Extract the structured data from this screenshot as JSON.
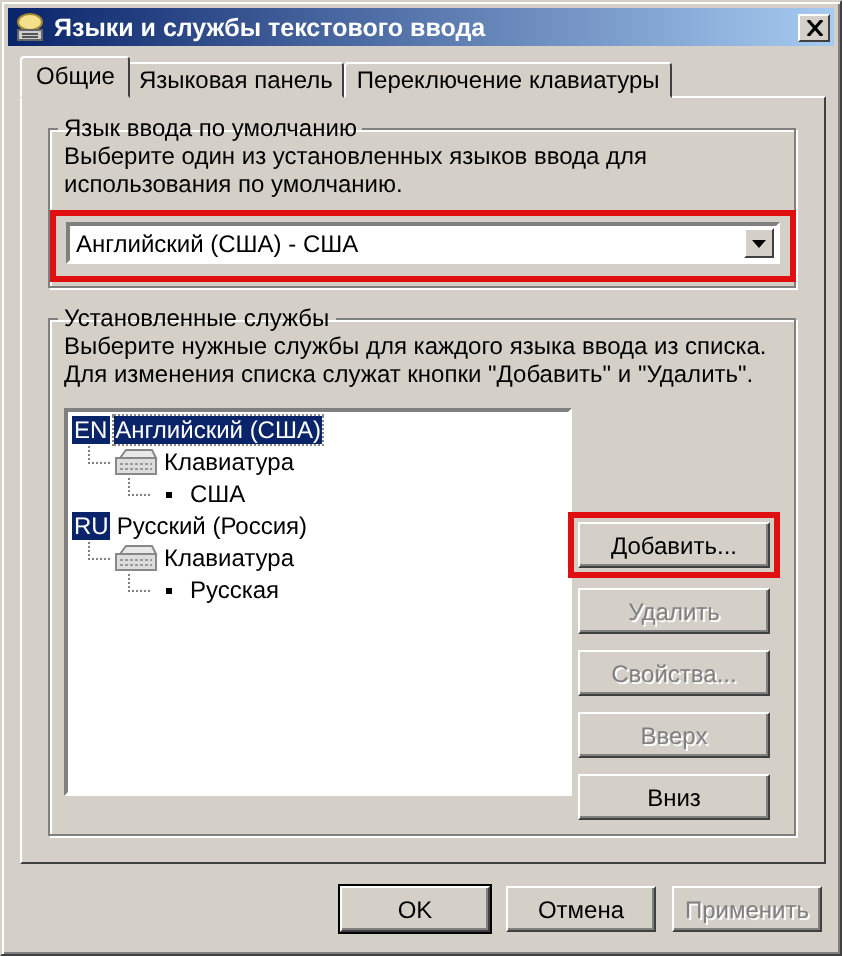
{
  "window": {
    "title": "Языки и службы текстового ввода"
  },
  "tabs": [
    {
      "label": "Общие",
      "selected": true
    },
    {
      "label": "Языковая панель",
      "selected": false
    },
    {
      "label": "Переключение клавиатуры",
      "selected": false
    }
  ],
  "default_language": {
    "legend": "Язык ввода по умолчанию",
    "description": "Выберите один из установленных языков ввода для использования по умолчанию.",
    "value": "Английский (США) - США",
    "highlighted": true
  },
  "installed_services": {
    "legend": "Установленные службы",
    "description": "Выберите нужные службы для каждого языка ввода из списка. Для изменения списка служат кнопки \"Добавить\" и \"Удалить\".",
    "tree": [
      {
        "kind": "language",
        "badge": "EN",
        "label": "Английский (США)",
        "selected": true,
        "children": [
          {
            "kind": "category",
            "label": "Клавиатура",
            "selected": false,
            "children": [
              {
                "kind": "service",
                "label": "США",
                "selected": false
              }
            ]
          }
        ]
      },
      {
        "kind": "language",
        "badge": "RU",
        "label": "Русский (Россия)",
        "selected": false,
        "children": [
          {
            "kind": "category",
            "label": "Клавиатура",
            "selected": false,
            "children": [
              {
                "kind": "service",
                "label": "Русская",
                "selected": false
              }
            ]
          }
        ]
      }
    ],
    "buttons": [
      {
        "label": "Добавить...",
        "disabled": false,
        "highlighted": true
      },
      {
        "label": "Удалить",
        "disabled": true,
        "highlighted": false
      },
      {
        "label": "Свойства...",
        "disabled": true,
        "highlighted": false
      },
      {
        "label": "Вверх",
        "disabled": true,
        "highlighted": false
      },
      {
        "label": "Вниз",
        "disabled": false,
        "highlighted": false
      }
    ]
  },
  "buttons": [
    {
      "label": "OK",
      "disabled": false,
      "default": true
    },
    {
      "label": "Отмена",
      "disabled": false,
      "default": false
    },
    {
      "label": "Применить",
      "disabled": true,
      "default": false
    }
  ]
}
